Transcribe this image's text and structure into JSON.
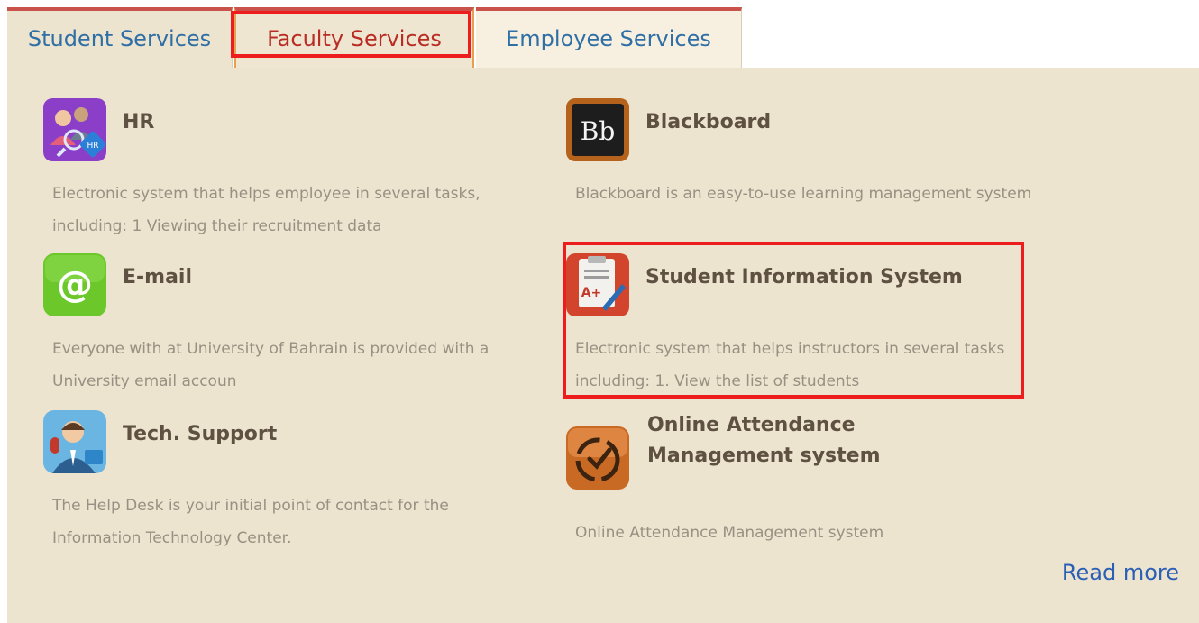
{
  "tabs": {
    "student": "Student Services",
    "faculty": "Faculty Services",
    "employee": "Employee Services"
  },
  "services": [
    {
      "icon": "hr-people-icon",
      "title": "HR",
      "description": "Electronic system that helps employee in several tasks, including: 1 Viewing their recruitment data"
    },
    {
      "icon": "blackboard-icon",
      "title": "Blackboard",
      "description": "Blackboard is an easy-to-use learning management system"
    },
    {
      "icon": "email-at-icon",
      "title": "E-mail",
      "description": "Everyone with at University of Bahrain is provided with a University email accoun"
    },
    {
      "icon": "student-grades-icon",
      "title": "Student Information System",
      "description": "Electronic system that helps instructors in several tasks including: 1. View the list of students"
    },
    {
      "icon": "tech-support-agent-icon",
      "title": "Tech. Support",
      "description": "The Help Desk is your initial point of contact for the Information Technology Center."
    },
    {
      "icon": "attendance-clock-icon",
      "title": "Online Attendance Management system",
      "description": "Online Attendance Management system"
    }
  ],
  "read_more": "Read more",
  "colors": {
    "tab_accent": "#c9524a",
    "tab_text": "#2f6fa5",
    "active_tab_text": "#b82c23",
    "panel_bg": "#ede4cf",
    "title_text": "#5e5142",
    "desc_text": "#9a8f82",
    "link": "#2a5fb5",
    "highlight": "#ee1d1d"
  }
}
